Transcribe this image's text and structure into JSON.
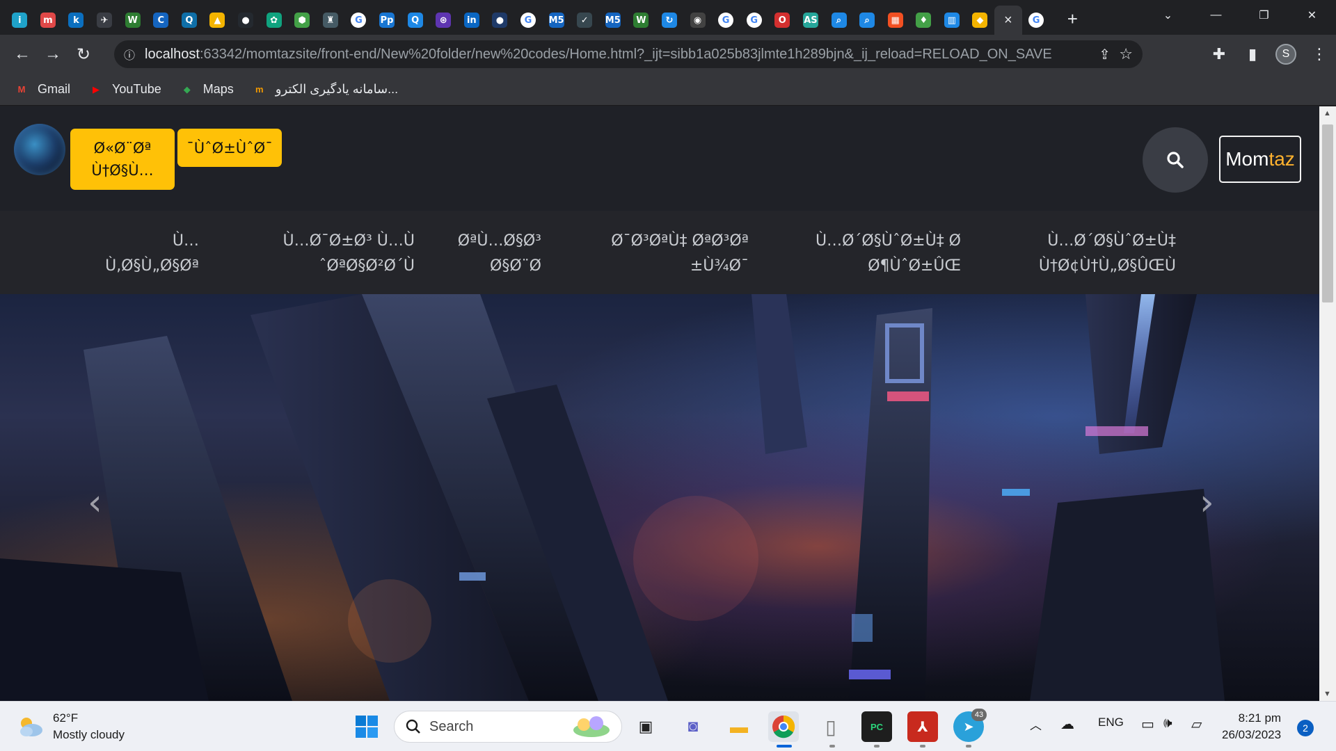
{
  "browser": {
    "tabs": [
      {
        "icon": "i",
        "color": "#1fa2c9"
      },
      {
        "icon": "m",
        "color": "#e04848"
      },
      {
        "icon": "k",
        "color": "#0b6fbf"
      },
      {
        "icon": "✈",
        "color": "#3a3d44"
      },
      {
        "icon": "W",
        "color": "#2e7d32"
      },
      {
        "icon": "C",
        "color": "#1565c0"
      },
      {
        "icon": "Q",
        "color": "#0f6fa8"
      },
      {
        "icon": "▲",
        "color": "#f4b400"
      },
      {
        "icon": "●",
        "color": "#24292f"
      },
      {
        "icon": "✿",
        "color": "#10a37f"
      },
      {
        "icon": "⬢",
        "color": "#43a047"
      },
      {
        "icon": "♜",
        "color": "#455a64"
      },
      {
        "icon": "G",
        "color": "#ffffff"
      },
      {
        "icon": "Pp",
        "color": "#1976d2"
      },
      {
        "icon": "Q",
        "color": "#1e88e5"
      },
      {
        "icon": "⊛",
        "color": "#5e35b1"
      },
      {
        "icon": "in",
        "color": "#0a66c2"
      },
      {
        "icon": "●",
        "color": "#1f3a68"
      },
      {
        "icon": "G",
        "color": "#ffffff"
      },
      {
        "icon": "M5",
        "color": "#1565c0"
      },
      {
        "icon": "✓",
        "color": "#37474f"
      },
      {
        "icon": "M5",
        "color": "#1565c0"
      },
      {
        "icon": "W",
        "color": "#2e7d32"
      },
      {
        "icon": "↻",
        "color": "#1e88e5"
      },
      {
        "icon": "◉",
        "color": "#424242"
      },
      {
        "icon": "G",
        "color": "#ffffff"
      },
      {
        "icon": "G",
        "color": "#ffffff"
      },
      {
        "icon": "O",
        "color": "#d32f2f"
      },
      {
        "icon": "AS",
        "color": "#26a69a"
      },
      {
        "icon": "⌕",
        "color": "#1e88e5"
      },
      {
        "icon": "⌕",
        "color": "#1e88e5"
      },
      {
        "icon": "▦",
        "color": "#f25022"
      },
      {
        "icon": "♦",
        "color": "#43a047"
      },
      {
        "icon": "▥",
        "color": "#1e88e5"
      },
      {
        "icon": "◆",
        "color": "#f4b400"
      },
      {
        "icon": "×",
        "color": "#35363a",
        "active": true
      },
      {
        "icon": "G",
        "color": "#ffffff"
      }
    ],
    "new_tab": "+",
    "url_host": "localhost",
    "url_rest": ":63342/momtazsite/front-end/New%20folder/new%20codes/Home.html?_ijt=sibb1a025b83jlmte1h289bjn&_ij_reload=RELOAD_ON_SAVE",
    "profile_initial": "S",
    "bookmarks": [
      {
        "label": "Gmail",
        "icon": "gmail-icon",
        "glyph": "M",
        "color": "#ea4335"
      },
      {
        "label": "YouTube",
        "icon": "youtube-icon",
        "glyph": "▶",
        "color": "#ff0000"
      },
      {
        "label": "Maps",
        "icon": "maps-icon",
        "glyph": "◆",
        "color": "#34a853"
      },
      {
        "label": "سامانه یادگیری الکترو...",
        "icon": "lms-icon",
        "glyph": "m",
        "color": "#f29900"
      }
    ]
  },
  "site": {
    "header_buttons": [
      "Ø«Ø¨Øª\nÙ†Ø§Ù…",
      "¯ÙˆØ±ÙˆØ¯"
    ],
    "brand_part1": "Mom",
    "brand_part2": "taz",
    "nav_links": [
      "Ù…\nÙ‚Ø§Ù„Ø§Øª",
      "Ù…Ø¯Ø±Ø³ Ù…Ù\nˆØªØ§Ø²Ø´Ù",
      "ØªÙ…Ø§Ø³\nØ§Ø¨Ø",
      "Ø¯Ø³ØªÙ‡ ØªØ³Øª\n±Ù¾Ø¯",
      "Ù…Ø´Ø§ÙˆØ±Ù‡ Ø­\nØ¶ÙˆØ±ÛŒ",
      "Ù…Ø´Ø§ÙˆØ±Ù‡\nÙ†Ø¢Ù†Ù„Ø§ÛŒÙ"
    ],
    "carousel_prev": "‹",
    "carousel_next": "›"
  },
  "taskbar": {
    "temp": "62°F",
    "condition": "Mostly cloudy",
    "search_placeholder": "Search",
    "lang": "ENG",
    "time": "8:21 pm",
    "date": "26/03/2023",
    "notifications": "2",
    "telegram_badge": "43"
  }
}
